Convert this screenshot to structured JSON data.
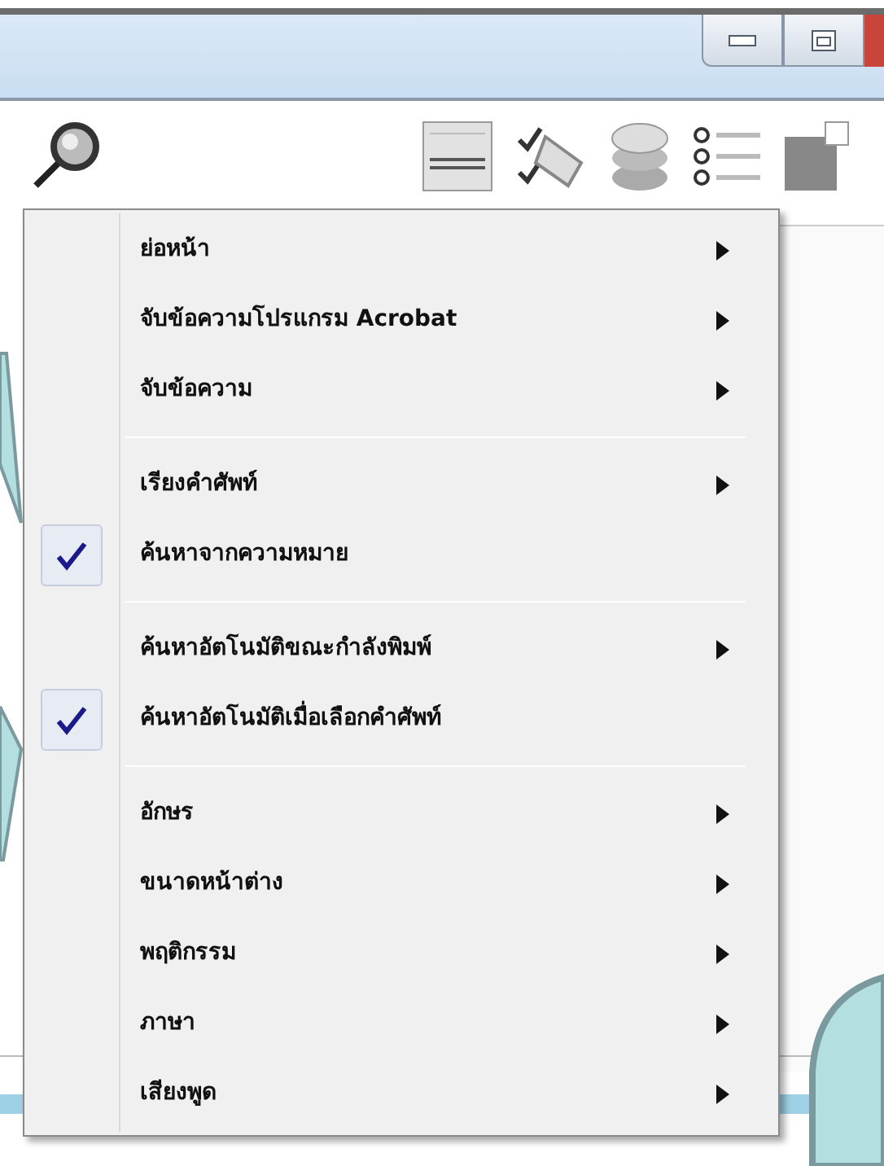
{
  "menu": {
    "items": [
      {
        "kind": "item",
        "label": "ย่อหน้า",
        "checked": false,
        "submenu": true
      },
      {
        "kind": "item",
        "label": "จับข้อความโปรแกรม Acrobat",
        "checked": false,
        "submenu": true
      },
      {
        "kind": "item",
        "label": "จับข้อความ",
        "checked": false,
        "submenu": true
      },
      {
        "kind": "separator"
      },
      {
        "kind": "item",
        "label": "เรียงคำศัพท์",
        "checked": false,
        "submenu": true
      },
      {
        "kind": "item",
        "label": "ค้นหาจากความหมาย",
        "checked": true,
        "submenu": false
      },
      {
        "kind": "separator"
      },
      {
        "kind": "item",
        "label": "ค้นหาอัตโนมัติขณะกำลังพิมพ์",
        "checked": false,
        "submenu": true
      },
      {
        "kind": "item",
        "label": "ค้นหาอัตโนมัติเมื่อเลือกคำศัพท์",
        "checked": true,
        "submenu": false
      },
      {
        "kind": "separator"
      },
      {
        "kind": "item",
        "label": "อักษร",
        "checked": false,
        "submenu": true
      },
      {
        "kind": "item",
        "label": "ขนาดหน้าต่าง",
        "checked": false,
        "submenu": true
      },
      {
        "kind": "item",
        "label": "พฤติกรรม",
        "checked": false,
        "submenu": true
      },
      {
        "kind": "item",
        "label": "ภาษา",
        "checked": false,
        "submenu": true
      },
      {
        "kind": "item",
        "label": "เสียงพูด",
        "checked": false,
        "submenu": true
      }
    ]
  }
}
